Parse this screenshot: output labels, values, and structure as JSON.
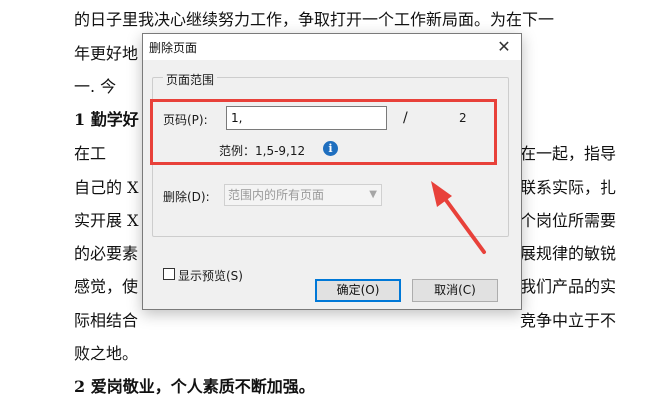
{
  "document": {
    "lines": [
      "的日子里我决心继续努力工作，争取打开一个工作新局面。为在下一",
      "年更好地",
      "一.     今",
      "1    勤学好",
      "       在工",
      "自己的 X",
      "实开展 X",
      "的必要素",
      "感觉，使",
      "际相结合",
      "败之地。",
      "2    爱岗敬业，个人素质不断加强。"
    ],
    "right_fragments": [
      "在一起，指导",
      "联系实际，扎",
      "个岗位所需要",
      "展规律的敏锐",
      "我们产品的实",
      "竞争中立于不"
    ]
  },
  "dialog": {
    "title": "删除页面",
    "close_glyph": "✕",
    "group_title": "页面范围",
    "page_label": "页码(P):",
    "page_value": "1,",
    "separator": "/",
    "total_pages": "2",
    "example_text": "范例：1,5-9,12",
    "info_glyph": "i",
    "delete_label": "删除(D):",
    "delete_option": "范围内的所有页面",
    "preview_label": "显示预览(S)",
    "ok_label": "确定(O)",
    "cancel_label": "取消(C)"
  },
  "colors": {
    "annotation": "#e8413a",
    "accent": "#0078d7",
    "info": "#1f6fbf"
  }
}
